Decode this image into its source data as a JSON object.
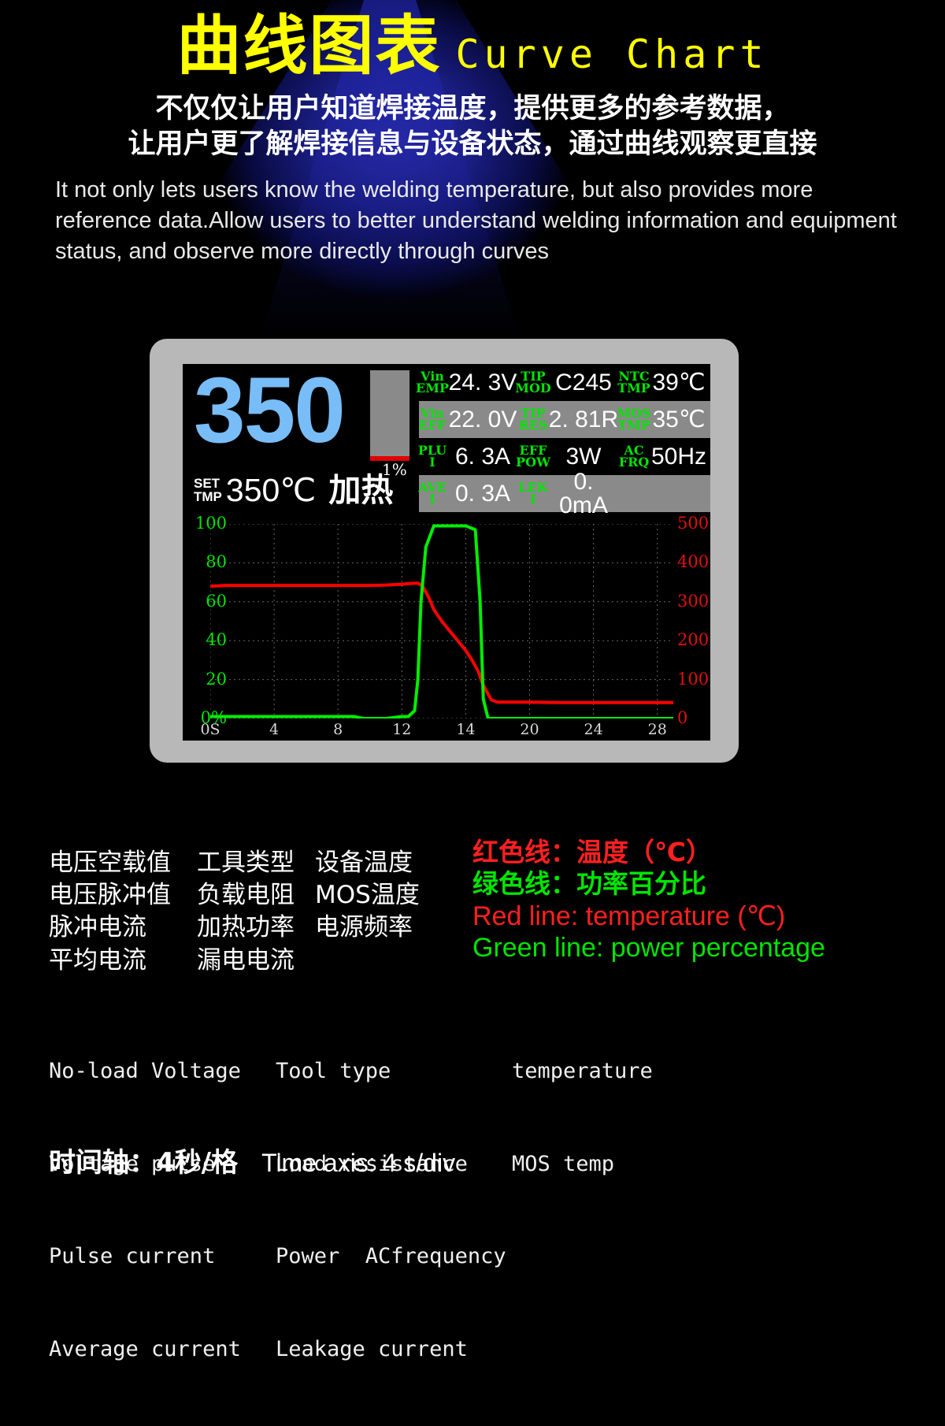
{
  "header": {
    "title_cn": "曲线图表",
    "title_en": "Curve Chart",
    "subtitle_cn_line1": "不仅仅让用户知道焊接温度，提供更多的参考数据，",
    "subtitle_cn_line2": "让用户更了解焊接信息与设备状态，通过曲线观察更直接",
    "subtitle_en": "It not only lets users know the welding temperature, but also provides more reference data.Allow users to better understand welding information and equipment status, and observe more directly through curves",
    "title_color": "#ffff00"
  },
  "device": {
    "big_temp": "350",
    "bar_percent_label": "1%",
    "bar_fill_percent": 1,
    "set_tmp_label_line1": "SET",
    "set_tmp_label_line2": "TMP",
    "set_tmp_value": "350℃",
    "mode_label": "加热",
    "telemetry": [
      [
        {
          "key1": "Vin",
          "key2": "EMP",
          "value": "24. 3V"
        },
        {
          "key1": "TIP",
          "key2": "MOD",
          "value": "C245"
        },
        {
          "key1": "NTC",
          "key2": "TMP",
          "value": "39℃"
        }
      ],
      [
        {
          "key1": "Vin",
          "key2": "EFF",
          "value": "22. 0V"
        },
        {
          "key1": "TIP",
          "key2": "RES",
          "value": "2. 81R"
        },
        {
          "key1": "MOS",
          "key2": "TMP",
          "value": "35℃"
        }
      ],
      [
        {
          "key1": "PLU",
          "key2": "I",
          "value": "6. 3A"
        },
        {
          "key1": "EFF",
          "key2": "POW",
          "value": "3W"
        },
        {
          "key1": "AC",
          "key2": "FRQ",
          "value": "50Hz"
        }
      ],
      [
        {
          "key1": "AVE",
          "key2": "I",
          "value": "0. 3A"
        },
        {
          "key1": "LEK",
          "key2": "I",
          "value": "0. 0mA"
        },
        {
          "key1": "",
          "key2": "",
          "value": ""
        }
      ]
    ]
  },
  "chart_data": {
    "type": "line",
    "title": "",
    "xlabel": "",
    "x_tick_labels": [
      "0S",
      "4",
      "8",
      "12",
      "14",
      "20",
      "24",
      "28"
    ],
    "x_tick_positions": [
      0,
      4,
      8,
      12,
      16,
      20,
      24,
      28
    ],
    "xlim": [
      0,
      29
    ],
    "grid": true,
    "legend_position": "below-chart",
    "left_axis": {
      "label": "power percentage",
      "color": "#00e400",
      "ticks": [
        "0%",
        "20",
        "40",
        "60",
        "80",
        "100"
      ],
      "tick_values": [
        0,
        20,
        40,
        60,
        80,
        100
      ],
      "ylim": [
        0,
        100
      ]
    },
    "right_axis": {
      "label": "temperature",
      "color": "#e01010",
      "ticks": [
        "0",
        "100",
        "200",
        "300",
        "400",
        "500"
      ],
      "tick_values": [
        0,
        100,
        200,
        300,
        400,
        500
      ],
      "ylim": [
        0,
        500
      ]
    },
    "series": [
      {
        "name": "Red line: temperature (℃)",
        "color": "#ff0000",
        "axis": "right",
        "x": [
          0,
          1,
          2,
          3,
          4,
          5,
          6,
          7,
          8,
          9,
          10,
          11,
          12,
          12.5,
          13,
          13.3,
          13.7,
          14,
          14.5,
          15,
          15.5,
          16,
          16.4,
          16.8,
          17,
          17.3,
          17.6,
          18,
          20,
          22,
          24,
          26,
          28,
          29
        ],
        "y": [
          340,
          342,
          342,
          342,
          342,
          342,
          342,
          342,
          342,
          342,
          342,
          343,
          345,
          347,
          348,
          340,
          310,
          280,
          250,
          225,
          200,
          175,
          150,
          120,
          95,
          70,
          48,
          42,
          42,
          41,
          41,
          41,
          41,
          41
        ]
      },
      {
        "name": "Green line: power percentage",
        "color": "#00ee00",
        "axis": "left",
        "x": [
          0,
          2,
          4,
          6,
          8,
          9,
          9.6,
          10,
          11,
          12,
          12.4,
          12.8,
          13,
          13.2,
          13.5,
          14,
          15,
          16,
          16.6,
          16.9,
          17.1,
          17.4,
          18,
          20,
          22,
          24,
          26,
          28,
          29
        ],
        "y": [
          1,
          1,
          1,
          1,
          1,
          1,
          0,
          0,
          0,
          1,
          1,
          4,
          20,
          60,
          88,
          99,
          99,
          99,
          97,
          60,
          10,
          0,
          0,
          0,
          0,
          0,
          0,
          0,
          0
        ]
      }
    ]
  },
  "legend_cn": {
    "rows": [
      [
        "电压空载值",
        "工具类型",
        "设备温度"
      ],
      [
        "电压脉冲值",
        "负载电阻",
        "MOS温度"
      ],
      [
        "脉冲电流",
        "加热功率",
        "电源频率"
      ],
      [
        "平均电流",
        "漏电电流",
        ""
      ]
    ]
  },
  "line_legend": {
    "cn_red": "红色线：温度（℃）",
    "cn_green": "绿色线：功率百分比",
    "en_red": "Red line: temperature (℃)",
    "en_green": "Green line: power percentage",
    "red_color": "#ff2020",
    "green_color": "#00e400"
  },
  "legend_en": {
    "rows": [
      [
        "No-load Voltage",
        "Tool type",
        "temperature"
      ],
      [
        "Voltage pulse",
        "Load resistance",
        "MOS temp"
      ],
      [
        "Pulse current",
        "Power  ACfrequency",
        ""
      ],
      [
        "Average current",
        "Leakage current",
        ""
      ]
    ]
  },
  "time_axis": {
    "cn": "时间轴：4秒/格",
    "en": "Time axis: 4 s/div"
  }
}
